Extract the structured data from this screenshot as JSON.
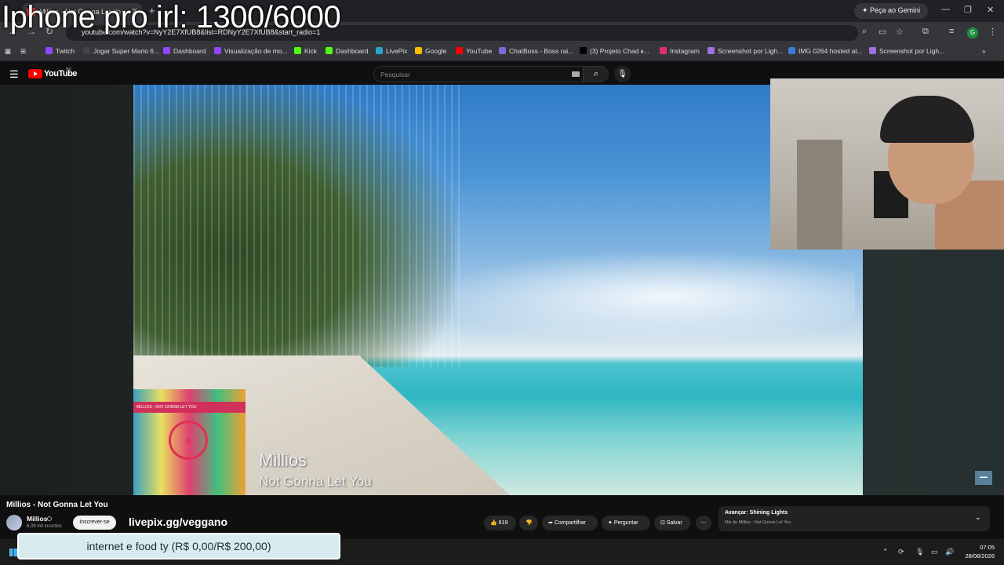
{
  "overlay": {
    "stream_title": "Iphone pro irl: 1300/6000",
    "donation_goal": "internet e food ty (R$ 0,00/R$ 200,00)"
  },
  "browser": {
    "tab_title": "Millios - Not Gonna Let Yo",
    "gemini_label": "Peça ao Gemini",
    "url": "youtube.com/watch?v=NyY2E7XfUB8&list=RDNyY2E7XfUB8&start_radio=1",
    "bookmarks": [
      {
        "label": "Twitch",
        "color": "#9146ff"
      },
      {
        "label": "Jogar Super Mario 6...",
        "color": "#444"
      },
      {
        "label": "Dashboard",
        "color": "#9146ff"
      },
      {
        "label": "Visualização de mo...",
        "color": "#9146ff"
      },
      {
        "label": "Kick",
        "color": "#53fc18"
      },
      {
        "label": "Dashboard",
        "color": "#53fc18"
      },
      {
        "label": "LivePix",
        "color": "#2aa3c7"
      },
      {
        "label": "Google",
        "color": "#fbbc05"
      },
      {
        "label": "YouTube",
        "color": "#ff0000"
      },
      {
        "label": "ChatBoss - Boss rai...",
        "color": "#7a6ad8"
      },
      {
        "label": "(3) Projeto Chad ᵻᵻ...",
        "color": "#000"
      },
      {
        "label": "Instagram",
        "color": "#e1306c"
      },
      {
        "label": "Screenshot por Ligh...",
        "color": "#a070e0"
      },
      {
        "label": "IMG 0264 hosted at...",
        "color": "#3a7bd5"
      },
      {
        "label": "Screenshot por Ligh...",
        "color": "#a070e0"
      }
    ]
  },
  "youtube": {
    "logo": "YouTube",
    "country": "BR",
    "search_placeholder": "Pesquisar",
    "video_overlay_artist": "Millios",
    "video_overlay_title": "Not Gonna Let You",
    "thumb_strip_text": "MILLIOS - NOT GONNA LET YOU",
    "title": "Millios - Not Gonna Let You",
    "channel": "Millios",
    "subscribers": "6,09 mil inscritos",
    "subscribe_label": "Inscrever-se",
    "promo": "livepix.gg/veggano",
    "like_count": "619",
    "share_label": "Compartilhar",
    "ask_label": "Perguntar",
    "save_label": "Salvar",
    "next_label": "Avançar: Shining Lights",
    "next_sub": "Mix de Millios - Not Gonna Let You"
  },
  "taskbar": {
    "time": "07:05",
    "date": "28/08/2026"
  }
}
